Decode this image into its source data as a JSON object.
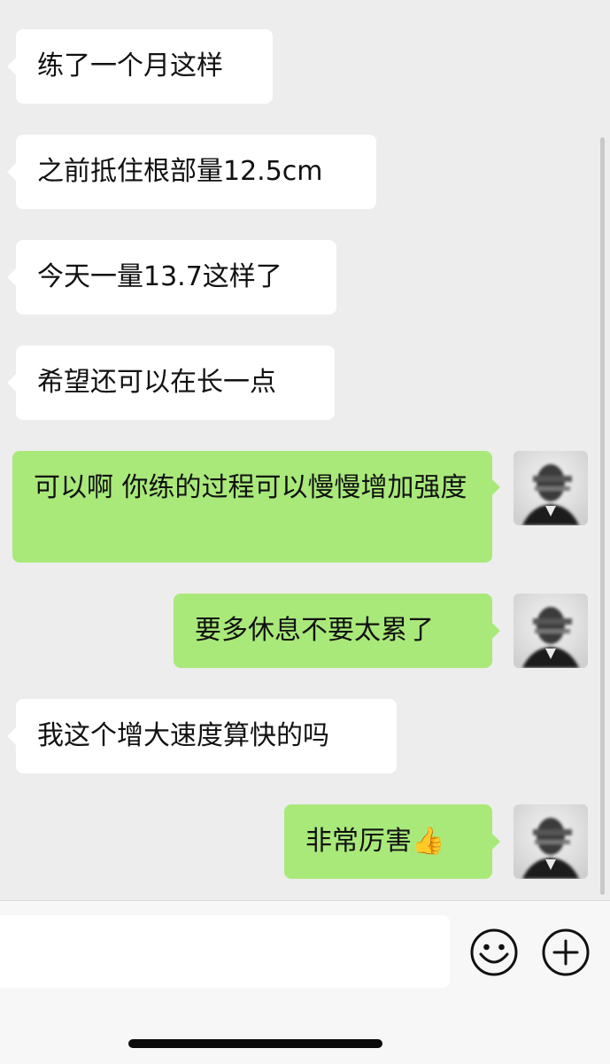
{
  "messages": [
    {
      "side": "in",
      "text": "练了一个月这样"
    },
    {
      "side": "in",
      "text": "之前抵住根部量12.5cm"
    },
    {
      "side": "in",
      "text": "今天一量13.7这样了"
    },
    {
      "side": "in",
      "text": "希望还可以在长一点"
    },
    {
      "side": "out",
      "text": "可以啊 你练的过程可以慢慢增加强度",
      "avatar": "avatar-blurred-person"
    },
    {
      "side": "out",
      "text": "要多休息不要太累了",
      "avatar": "avatar-blurred-person"
    },
    {
      "side": "in",
      "text": "我这个增大速度算快的吗"
    },
    {
      "side": "out",
      "text": "非常厉害",
      "emoji": "👍",
      "avatar": "avatar-blurred-person"
    }
  ],
  "input_bar": {
    "text_value": "",
    "emoji_icon": "smiley-face-icon",
    "more_icon": "plus-circle-icon"
  },
  "colors": {
    "background": "#ededed",
    "incoming_bubble": "#ffffff",
    "outgoing_bubble": "#a9e97a"
  }
}
